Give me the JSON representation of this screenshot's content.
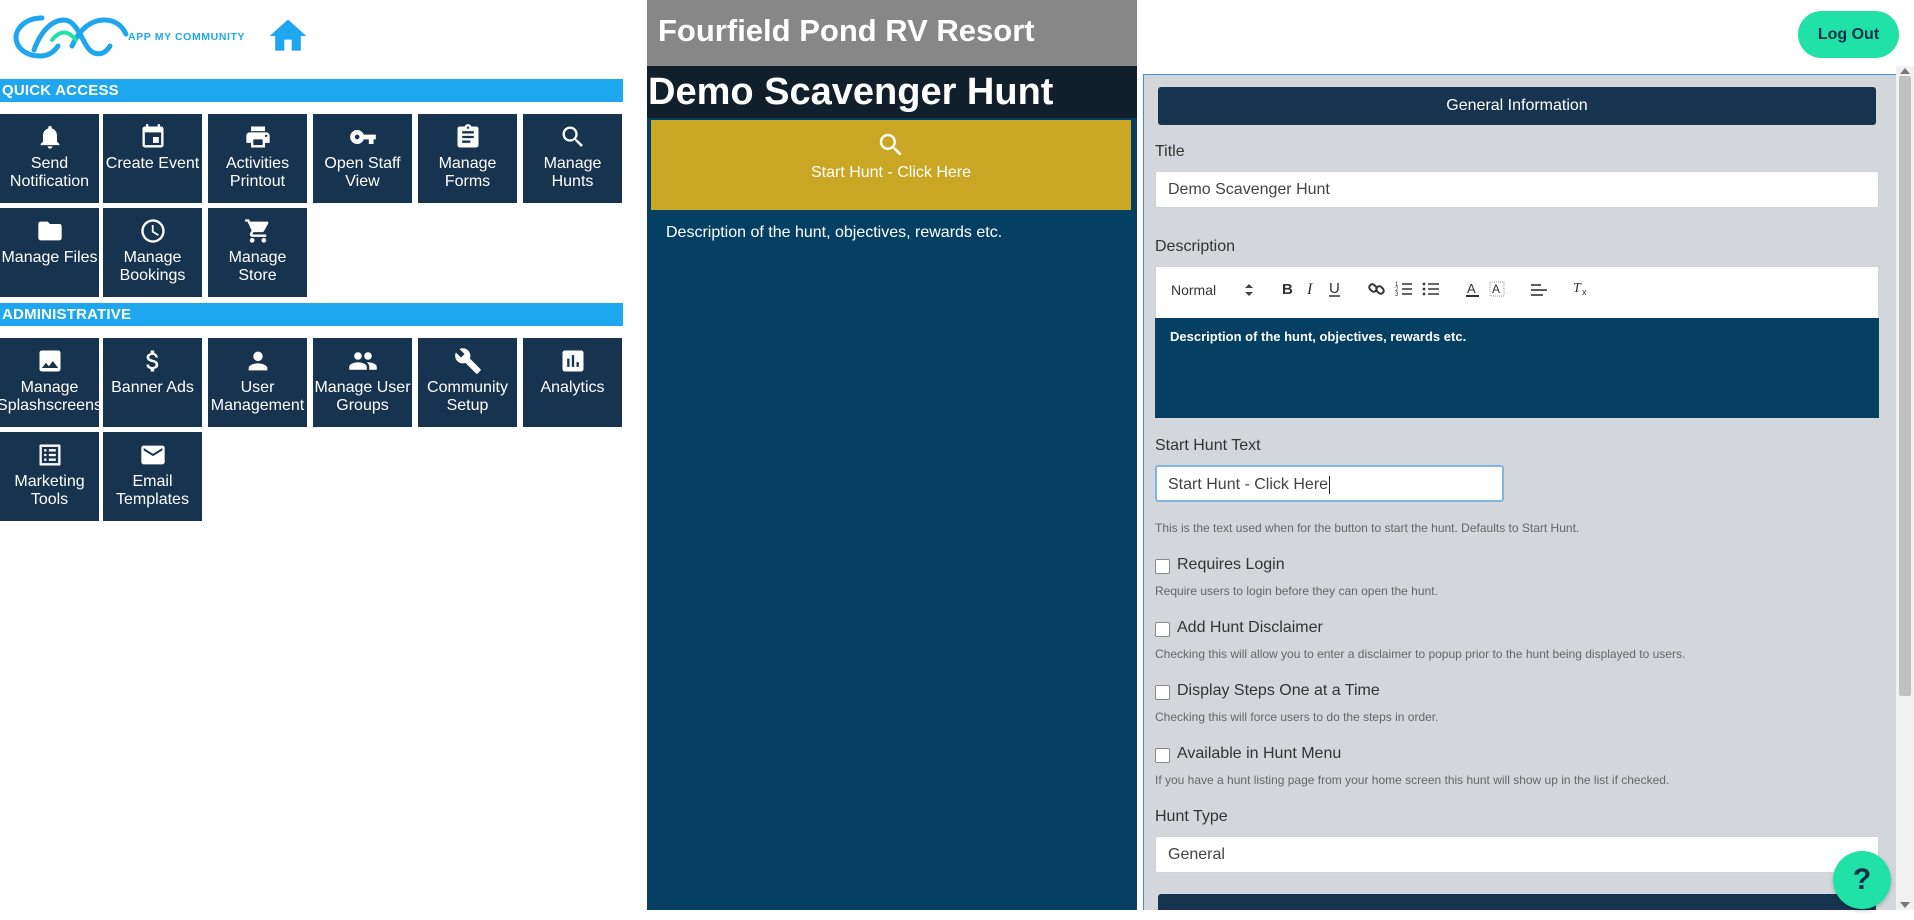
{
  "logo": {
    "alt_text": "APP MY COMMUNITY",
    "color": "#1ea7ee"
  },
  "sections": {
    "quick_access": "QUICK ACCESS",
    "administrative": "ADMINISTRATIVE"
  },
  "quick_access": [
    {
      "label": "Send Notification",
      "icon": "bell-icon"
    },
    {
      "label": "Create Event",
      "icon": "calendar-icon"
    },
    {
      "label": "Activities Printout",
      "icon": "printer-icon"
    },
    {
      "label": "Open Staff View",
      "icon": "key-icon"
    },
    {
      "label": "Manage Forms",
      "icon": "clipboard-icon"
    },
    {
      "label": "Manage Hunts",
      "icon": "search-icon"
    },
    {
      "label": "Manage Files",
      "icon": "folder-icon"
    },
    {
      "label": "Manage Bookings",
      "icon": "clock-icon"
    },
    {
      "label": "Manage Store",
      "icon": "cart-icon"
    }
  ],
  "administrative": [
    {
      "label": "Manage Splashscreens",
      "icon": "image-icon"
    },
    {
      "label": "Banner Ads",
      "icon": "dollar-icon"
    },
    {
      "label": "User Management",
      "icon": "person-icon"
    },
    {
      "label": "Manage User Groups",
      "icon": "group-icon"
    },
    {
      "label": "Community Setup",
      "icon": "wrench-icon"
    },
    {
      "label": "Analytics",
      "icon": "bar-chart-icon"
    },
    {
      "label": "Marketing Tools",
      "icon": "list-icon"
    },
    {
      "label": "Email Templates",
      "icon": "envelope-icon"
    }
  ],
  "preview": {
    "resort_name": "Fourfield Pond RV Resort",
    "hunt_title": "Demo Scavenger Hunt",
    "start_button": "Start Hunt - Click Here",
    "description": "Description of the hunt, objectives, rewards etc."
  },
  "header": {
    "logout_label": "Log Out"
  },
  "form": {
    "section_title": "General Information",
    "title_label": "Title",
    "title_value": "Demo Scavenger Hunt",
    "description_label": "Description",
    "editor_format": "Normal",
    "description_value": "Description of the hunt, objectives, rewards etc.",
    "start_text_label": "Start Hunt Text",
    "start_text_value": "Start Hunt - Click Here",
    "start_text_help": "This is the text used when for the button to start the hunt. Defaults to Start Hunt.",
    "requires_login_label": "Requires Login",
    "requires_login_help": "Require users to login before they can open the hunt.",
    "requires_login_checked": false,
    "disclaimer_label": "Add Hunt Disclaimer",
    "disclaimer_help": "Checking this will allow you to enter a disclaimer to popup prior to the hunt being displayed to users.",
    "disclaimer_checked": false,
    "steps_label": "Display Steps One at a Time",
    "steps_help": "Checking this will force users to do the steps in order.",
    "steps_checked": false,
    "menu_label": "Available in Hunt Menu",
    "menu_help": "If you have a hunt listing page from your home screen this hunt will show up in the list if checked.",
    "menu_checked": false,
    "hunt_type_label": "Hunt Type",
    "hunt_type_value": "General"
  },
  "help_button": "?",
  "colors": {
    "tile": "#163450",
    "section_bar": "#1ea7ee",
    "accent_green": "#20e2a6",
    "start_button": "#c9a623",
    "preview_bg": "#053f61"
  }
}
